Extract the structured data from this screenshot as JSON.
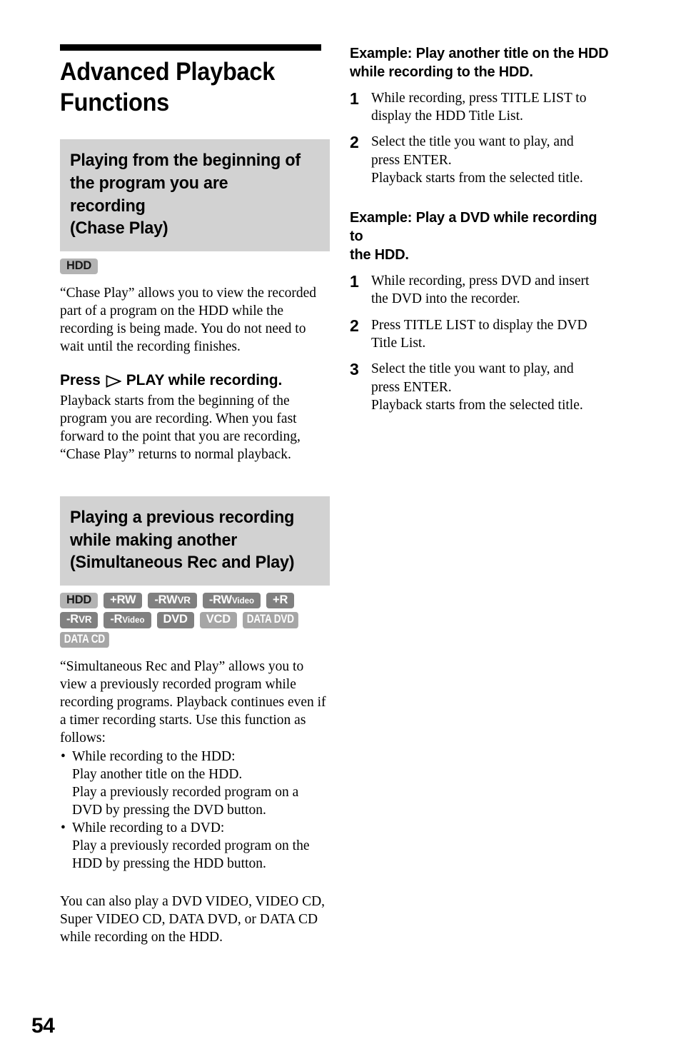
{
  "page": {
    "number": "54"
  },
  "chapter": {
    "title_line1": "Advanced Playback",
    "title_line2": "Functions"
  },
  "left_column": {
    "section1": {
      "heading_line1": "Playing from the beginning of",
      "heading_line2": "the program you are recording",
      "heading_line3": "(Chase Play)",
      "badges": [
        {
          "label": "HDD",
          "style": "light"
        }
      ],
      "paragraph1_lines": [
        "“Chase Play” allows you to view the",
        "recorded part of a program on the HDD",
        "while the recording is being made. You do",
        "not need to wait until the recording finishes."
      ],
      "press_heading_before": "Press",
      "press_icon": "play-triangle-outline-icon",
      "press_heading_after": "PLAY while recording.",
      "paragraph2_lines": [
        "Playback starts from the beginning of the",
        "program you are recording.",
        "When you fast forward to the point that you",
        "are recording, “Chase Play” returns to",
        "normal playback."
      ]
    },
    "section2": {
      "heading_line1": "Playing a previous recording",
      "heading_line2": "while making another",
      "heading_line3": "(Simultaneous Rec and Play)",
      "badge_rows": [
        [
          {
            "main": "HDD",
            "sub": "",
            "style": "light"
          },
          {
            "main": "+RW",
            "sub": "",
            "style": "dark"
          },
          {
            "main": "-RW",
            "sub": "VR",
            "sub_size": "vr",
            "style": "dark"
          },
          {
            "main": "-RW",
            "sub": "Video",
            "sub_size": "small",
            "style": "dark"
          },
          {
            "main": "+R",
            "sub": "",
            "style": "dark"
          }
        ],
        [
          {
            "main": "-R",
            "sub": "VR",
            "sub_size": "vr",
            "style": "dark"
          },
          {
            "main": "-R",
            "sub": "Video",
            "sub_size": "small",
            "style": "dark"
          },
          {
            "main": "DVD",
            "sub": "",
            "style": "dark"
          },
          {
            "main": "VCD",
            "sub": "",
            "style": "pale"
          },
          {
            "main": "DATA DVD",
            "sub": "",
            "style": "pale",
            "narrow": true
          }
        ],
        [
          {
            "main": "DATA CD",
            "sub": "",
            "style": "pale",
            "narrow": true
          }
        ]
      ],
      "paragraph1_lines": [
        "“Simultaneous Rec and Play” allows you to",
        "view a previously recorded program while",
        "recording programs. Playback continues",
        "even if a timer recording starts. Use this",
        "function as follows:"
      ],
      "bullets": [
        {
          "head": "While recording to the HDD:",
          "lines": [
            "Play another title on the HDD.",
            "Play a previously recorded program on a",
            "DVD by pressing the DVD button."
          ]
        },
        {
          "head": "While recording to a DVD:",
          "lines": [
            "Play a previously recorded program on the",
            "HDD by pressing the HDD button."
          ]
        }
      ],
      "paragraph2_lines": [
        "You can also play a DVD VIDEO, VIDEO",
        "CD, Super VIDEO CD, DATA DVD, or",
        "DATA CD while recording on the HDD."
      ]
    }
  },
  "right_column": {
    "example1": {
      "heading_line1": "Example: Play another title on the HDD",
      "heading_line2": "while recording to the HDD.",
      "steps": [
        {
          "num": "1",
          "lines": [
            "While recording, press TITLE LIST to",
            "display the HDD Title List."
          ]
        },
        {
          "num": "2",
          "lines": [
            "Select the title you want to play, and",
            "press ENTER.",
            "Playback starts from the selected title."
          ]
        }
      ]
    },
    "example2": {
      "heading_line1": "Example: Play a DVD while recording to",
      "heading_line2": "the HDD.",
      "steps": [
        {
          "num": "1",
          "lines": [
            "While recording, press DVD and insert",
            "the DVD into the recorder."
          ]
        },
        {
          "num": "2",
          "lines": [
            "Press TITLE LIST to display the DVD",
            "Title List."
          ]
        },
        {
          "num": "3",
          "lines": [
            "Select the title you want to play, and",
            "press ENTER.",
            "Playback starts from the selected title."
          ]
        }
      ]
    }
  },
  "colors": {
    "section_header_bg": "#d2d2d2",
    "badge_dark": "#808080",
    "badge_light": "#b3b3b3",
    "badge_pale": "#a6a6a6",
    "text": "#000000"
  }
}
